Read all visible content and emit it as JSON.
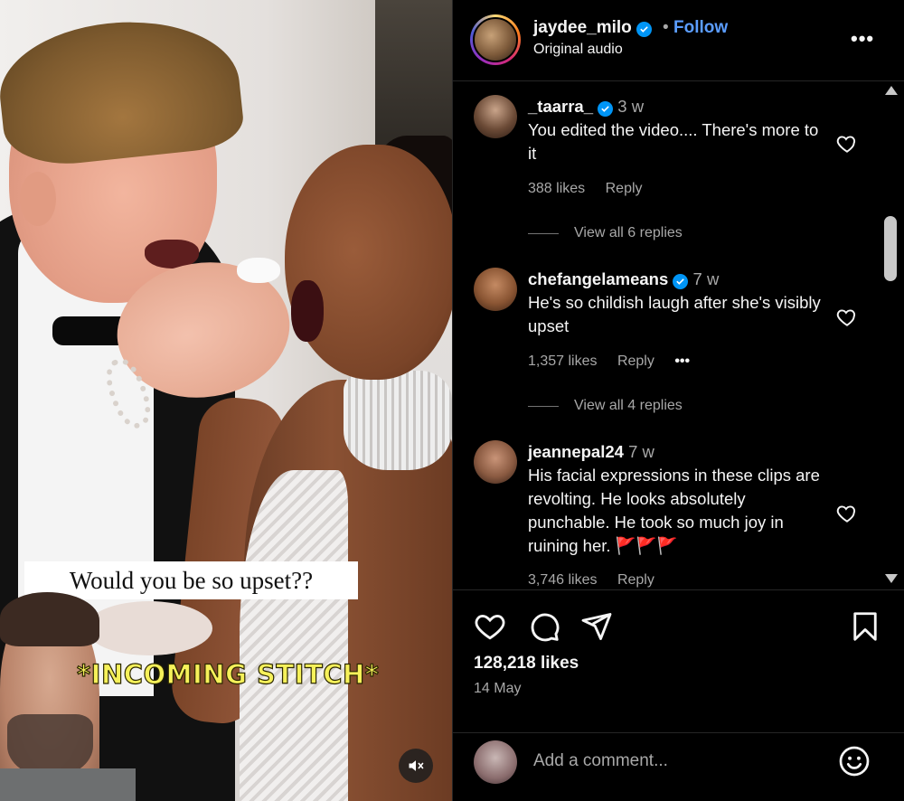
{
  "media": {
    "caption": "Would you be so upset??",
    "stitch_label": "*INCOMING STITCH*",
    "mute_icon": "speaker-muted-icon"
  },
  "post_header": {
    "username": "jaydee_milo",
    "separator": "•",
    "follow_label": "Follow",
    "subtitle": "Original audio",
    "more_icon": "more-options-icon",
    "more_label": "•••"
  },
  "comments": [
    {
      "username": "_taarra_",
      "verified": true,
      "time": "3 w",
      "text": "You edited the video.... There's more to it",
      "likes": "388 likes",
      "reply_label": "Reply",
      "view_replies": "View all 6 replies"
    },
    {
      "username": "chefangelameans",
      "verified": true,
      "time": "7 w",
      "text": "He's so childish laugh after she's visibly upset",
      "likes": "1,357 likes",
      "reply_label": "Reply",
      "more_label": "•••",
      "view_replies": "View all 4 replies"
    },
    {
      "username": "jeannepal24",
      "verified": false,
      "time": "7 w",
      "text": "His facial expressions in these clips are revolting. He looks absolutely punchable. He took so much joy in ruining her. 🚩🚩🚩",
      "likes": "3,746 likes",
      "reply_label": "Reply"
    }
  ],
  "actions": {
    "like_icon": "heart-icon",
    "comment_icon": "comment-icon",
    "share_icon": "share-icon",
    "save_icon": "bookmark-icon",
    "likes": "128,218 likes",
    "date": "14 May"
  },
  "comment_box": {
    "placeholder": "Add a comment...",
    "emoji_icon": "emoji-icon"
  },
  "colors": {
    "background": "#000000",
    "follow": "#5b9dff",
    "verified": "#0095f6",
    "secondary_text": "#a8a8a8",
    "stitch_text": "#f6f15a"
  }
}
